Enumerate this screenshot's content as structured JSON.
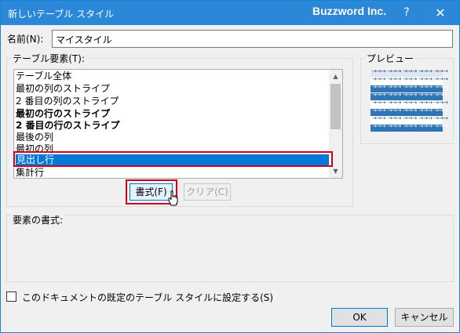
{
  "window": {
    "title": "新しいテーブル スタイル",
    "brand": "Buzzword Inc.",
    "help_label": "?",
    "close_label": "✕"
  },
  "name_field": {
    "label": "名前(N):",
    "value": "マイスタイル"
  },
  "elements": {
    "label": "テーブル要素(T):",
    "items": [
      {
        "label": "テーブル全体",
        "bold": false
      },
      {
        "label": "最初の列のストライプ",
        "bold": false
      },
      {
        "label": "2 番目の列のストライプ",
        "bold": false
      },
      {
        "label": "最初の行のストライプ",
        "bold": true
      },
      {
        "label": "2 番目の行のストライプ",
        "bold": true
      },
      {
        "label": "最後の列",
        "bold": false
      },
      {
        "label": "最初の列",
        "bold": false
      },
      {
        "label": "見出し行",
        "bold": false,
        "selected": true
      },
      {
        "label": "集計行",
        "bold": false
      }
    ],
    "format_button": "書式(F)",
    "clear_button": "クリア(C)"
  },
  "preview": {
    "label": "プレビュー",
    "arrows": "→→→ →→→ →→→ →→→ →→→"
  },
  "element_format": {
    "label": "要素の書式:"
  },
  "default_checkbox": {
    "label": "このドキュメントの既定のテーブル スタイルに設定する(S)",
    "checked": false
  },
  "buttons": {
    "ok": "OK",
    "cancel": "キャンセル"
  },
  "colors": {
    "titlebar": "#2b88d8",
    "selection": "#0078d7",
    "highlight": "#d0021b",
    "preview_dark": "#2e75b6"
  }
}
